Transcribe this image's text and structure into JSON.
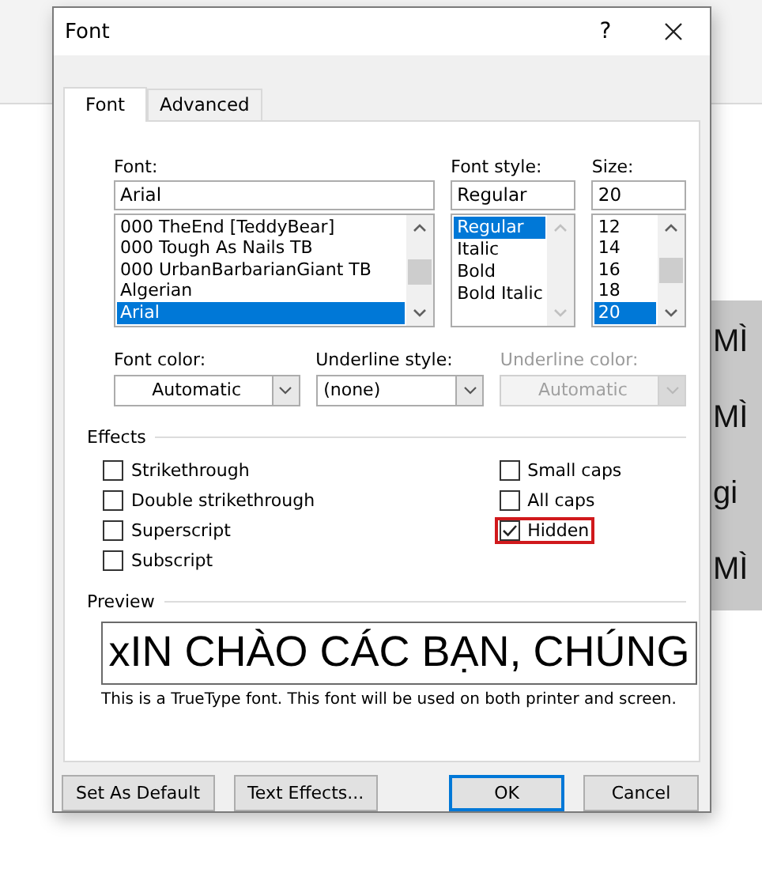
{
  "document": {
    "lines": [
      "MÌ",
      "MÌ",
      "gi",
      "MÌ"
    ]
  },
  "dialog": {
    "title": "Font",
    "help": "?",
    "tabs": [
      {
        "label": "Font",
        "selected": true
      },
      {
        "label": "Advanced",
        "selected": false
      }
    ],
    "font": {
      "label": "Font:",
      "value": "Arial",
      "items": [
        {
          "label": "000 TheEnd [TeddyBear]",
          "selected": false
        },
        {
          "label": "000 Tough As Nails TB",
          "selected": false
        },
        {
          "label": "000 UrbanBarbarianGiant TB",
          "selected": false
        },
        {
          "label": "Algerian",
          "selected": false
        },
        {
          "label": "Arial",
          "selected": true
        }
      ]
    },
    "font_style": {
      "label": "Font style:",
      "value": "Regular",
      "items": [
        {
          "label": "Regular",
          "selected": true
        },
        {
          "label": "Italic",
          "selected": false
        },
        {
          "label": "Bold",
          "selected": false
        },
        {
          "label": "Bold Italic",
          "selected": false
        }
      ]
    },
    "size": {
      "label": "Size:",
      "value": "20",
      "items": [
        {
          "label": "12",
          "selected": false
        },
        {
          "label": "14",
          "selected": false
        },
        {
          "label": "16",
          "selected": false
        },
        {
          "label": "18",
          "selected": false
        },
        {
          "label": "20",
          "selected": true
        }
      ]
    },
    "dropdowns": [
      {
        "label": "Font color:",
        "value": "Automatic",
        "disabled": false,
        "centered": true
      },
      {
        "label": "Underline style:",
        "value": "(none)",
        "disabled": false,
        "centered": false
      },
      {
        "label": "Underline color:",
        "value": "Automatic",
        "disabled": true,
        "centered": true
      }
    ],
    "effects": {
      "label": "Effects",
      "left": [
        {
          "label": "Strikethrough",
          "checked": false,
          "highlighted": false
        },
        {
          "label": "Double strikethrough",
          "checked": false,
          "highlighted": false
        },
        {
          "label": "Superscript",
          "checked": false,
          "highlighted": false
        },
        {
          "label": "Subscript",
          "checked": false,
          "highlighted": false
        }
      ],
      "right": [
        {
          "label": "Small caps",
          "checked": false,
          "highlighted": false
        },
        {
          "label": "All caps",
          "checked": false,
          "highlighted": false
        },
        {
          "label": "Hidden",
          "checked": true,
          "highlighted": true
        }
      ]
    },
    "preview": {
      "label": "Preview",
      "text": "xIN CHÀO CÁC BẠN, CHÚNG",
      "note": "This is a TrueType font. This font will be used on both printer and screen."
    },
    "left_buttons": [
      {
        "label": "Set As Default",
        "default": false
      },
      {
        "label": "Text Effects...",
        "default": false
      }
    ],
    "right_buttons": [
      {
        "label": "OK",
        "default": true
      },
      {
        "label": "Cancel",
        "default": false
      }
    ]
  }
}
